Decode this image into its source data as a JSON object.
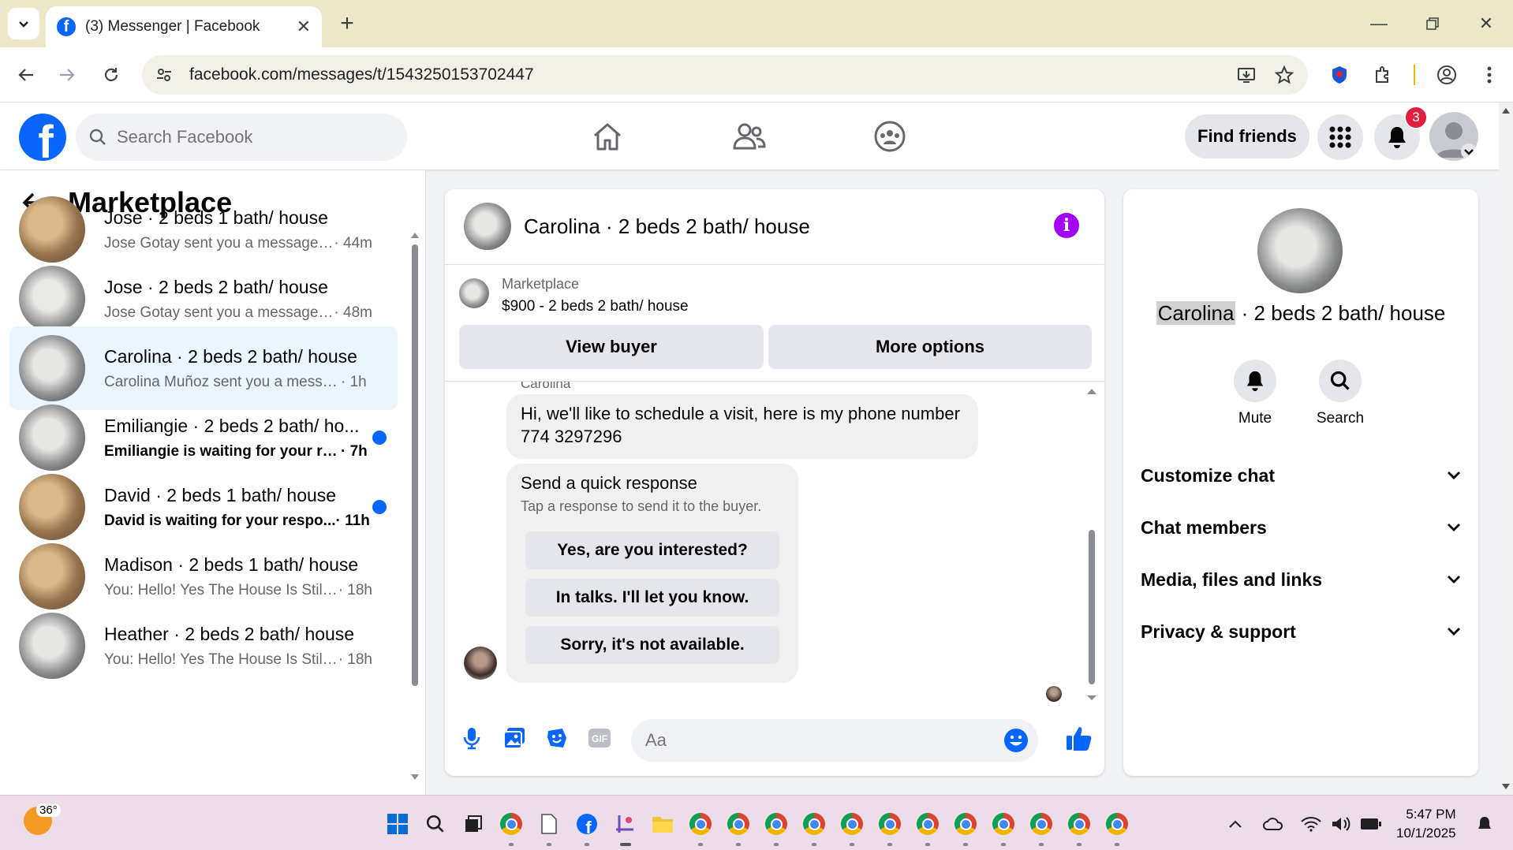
{
  "browser": {
    "tab_title": "(3) Messenger | Facebook",
    "url": "facebook.com/messages/t/1543250153702447"
  },
  "fb_header": {
    "search_placeholder": "Search Facebook",
    "find_friends_label": "Find friends",
    "notification_count": "3"
  },
  "sidebar": {
    "title": "Marketplace",
    "conversations": [
      {
        "title": "Jose · 2 beds 1 bath/ house",
        "snippet": "Jose Gotay sent you a message a...",
        "time": " · 44m",
        "unread": false,
        "active": false
      },
      {
        "title": "Jose · 2 beds 2 bath/ house",
        "snippet": "Jose Gotay sent you a message a...",
        "time": " · 48m",
        "unread": false,
        "active": false
      },
      {
        "title": "Carolina · 2 beds 2 bath/ house",
        "snippet": "Carolina Muñoz sent you a messag...",
        "time": " · 1h",
        "unread": false,
        "active": true
      },
      {
        "title": "Emiliangie · 2 beds 2 bath/ ho...",
        "snippet": "Emiliangie is waiting for your re...",
        "time": " · 7h",
        "unread": true,
        "active": false
      },
      {
        "title": "David · 2 beds 1 bath/ house",
        "snippet": "David is waiting for your respo...",
        "time": " · 11h",
        "unread": true,
        "active": false
      },
      {
        "title": "Madison · 2 beds 1 bath/ house",
        "snippet": "You: Hello! Yes The House Is Still A...",
        "time": " · 18h",
        "unread": false,
        "active": false
      },
      {
        "title": "Heather · 2 beds 2 bath/ house",
        "snippet": "You: Hello! Yes The House Is Still A...",
        "time": " · 18h",
        "unread": false,
        "active": false
      }
    ]
  },
  "chat": {
    "title": "Carolina · 2 beds 2 bath/ house",
    "listing_source": "Marketplace",
    "listing_name": "$900 - 2 beds 2 bath/ house",
    "view_buyer_label": "View buyer",
    "more_options_label": "More options",
    "sender_name": "Carolina",
    "message_text": "Hi, we'll like to schedule a visit, here is my phone number 774 3297296",
    "quick_response_title": "Send a quick response",
    "quick_response_subtitle": "Tap a response to send it to the buyer.",
    "quick_responses": [
      "Yes, are you interested?",
      "In talks. I'll let you know.",
      "Sorry, it's not available."
    ],
    "input_placeholder": "Aa"
  },
  "info_panel": {
    "name_highlight": "Carolina",
    "name_rest": " · 2 beds 2 bath/ house",
    "mute_label": "Mute",
    "search_label": "Search",
    "sections": [
      "Customize chat",
      "Chat members",
      "Media, files and links",
      "Privacy & support"
    ]
  },
  "taskbar": {
    "temperature": "36°",
    "time": "5:47 PM",
    "date": "10/1/2025"
  },
  "colors": {
    "fb_blue": "#0866ff",
    "active_convo_bg": "#ebf5ff",
    "info_purple": "#a100f2",
    "notification_red": "#e41e3f"
  }
}
